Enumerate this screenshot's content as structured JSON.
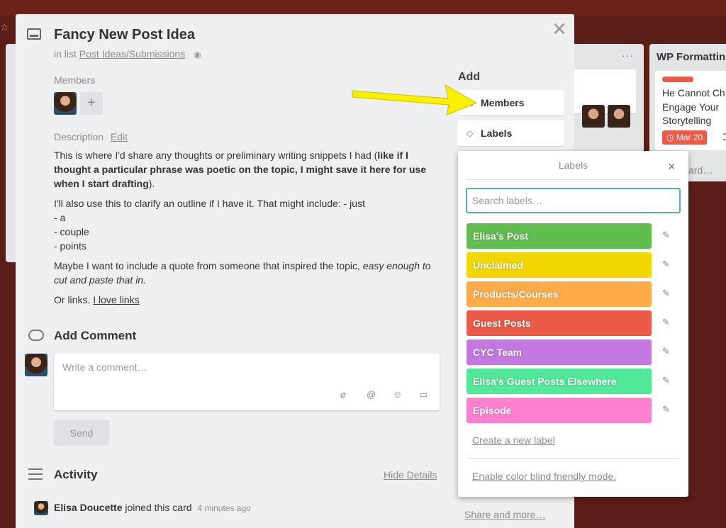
{
  "board": {
    "background_color": "#5a1d17",
    "list_menu_icon": "ellipsis-icon",
    "right_list": {
      "title": "WP Formatting",
      "card_text": "He Cannot Ch\nEngage Your \nStorytelling",
      "due": "Mar 20",
      "add_card": "card…"
    }
  },
  "card": {
    "title": "Fancy New Post Idea",
    "in_list_prefix": "in list",
    "list_name": "Post Ideas/Submissions",
    "members_heading": "Members",
    "add_member_symbol": "+",
    "description_heading": "Description",
    "edit_link": "Edit",
    "description": {
      "p1_start": "This is where I'd share any thoughts or preliminary writing snippets I had (",
      "p1_bold": "like if I thought a particular phrase was poetic on the topic, I might save it here for use when I start drafting",
      "p1_end": ").",
      "p2_line1": "I'll also use this to clarify an outline if I have it. That might include: - just",
      "p2_line2": "- a",
      "p2_line3": "- couple",
      "p2_line4": "- points",
      "p3_start": "Maybe I want to include a quote from someone that inspired the topic, ",
      "p3_italic": "easy enough to cut and paste that in.",
      "p4_start": "Or links. ",
      "p4_link": "I love links"
    },
    "add_comment_heading": "Add Comment",
    "comment_placeholder": "Write a comment…",
    "send_button": "Send",
    "activity_heading": "Activity",
    "hide_details": "Hide Details",
    "activity": [
      {
        "user": "Elisa Doucette",
        "action": "joined this card",
        "time": "4 minutes ago"
      }
    ]
  },
  "sidebar": {
    "add_heading": "Add",
    "members_button": "Members",
    "labels_button": "Labels",
    "share_link": "Share and more…"
  },
  "labels_popover": {
    "title": "Labels",
    "close_symbol": "×",
    "search_placeholder": "Search labels…",
    "labels": [
      {
        "name": "Elisa's Post",
        "color": "#61bd4f"
      },
      {
        "name": "Unclaimed",
        "color": "#f2d600"
      },
      {
        "name": "Products/Courses",
        "color": "#ffab4a"
      },
      {
        "name": "Guest Posts",
        "color": "#eb5a46"
      },
      {
        "name": "CYC Team",
        "color": "#c377e0"
      },
      {
        "name": "Elisa's Guest Posts Elsewhere",
        "color": "#51e898"
      },
      {
        "name": "Episode",
        "color": "#ff80ce"
      }
    ],
    "create_label": "Create a new label",
    "colorblind_mode": "Enable color blind friendly mode."
  },
  "annotation": {
    "arrow_color": "#f9f000"
  }
}
